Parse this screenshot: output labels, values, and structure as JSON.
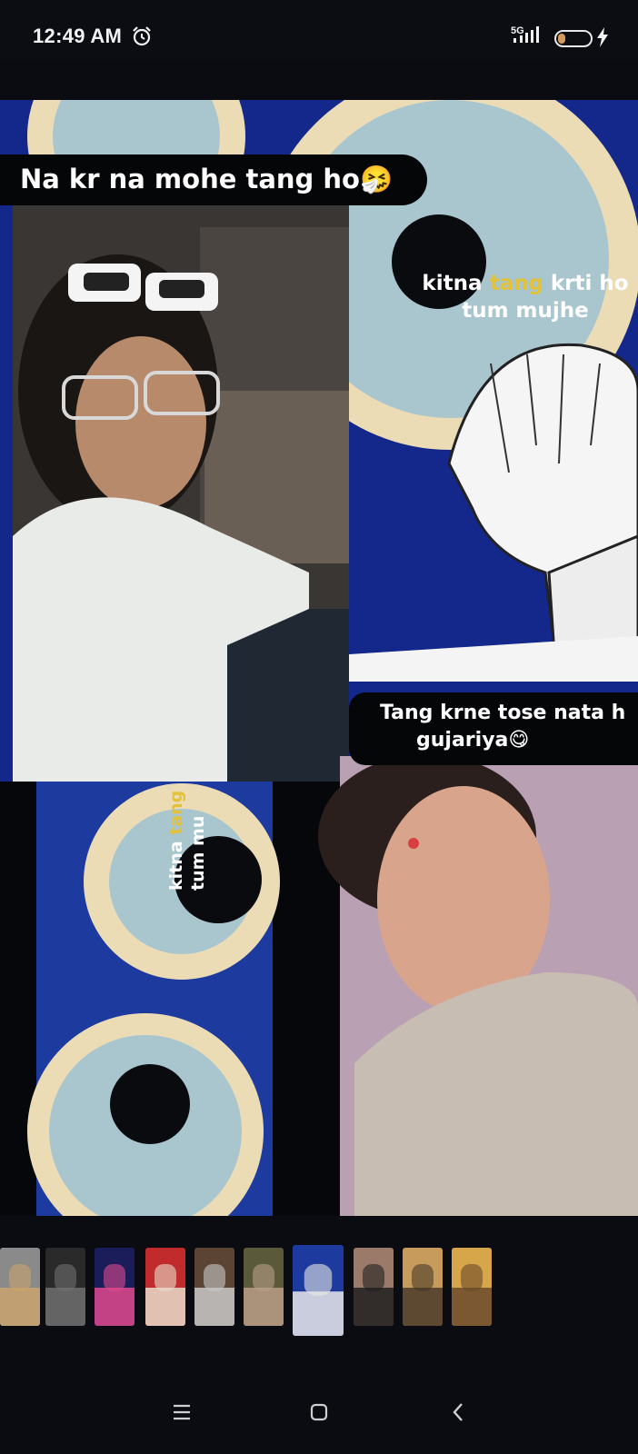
{
  "status_bar": {
    "time": "12:49 AM",
    "network": "5G",
    "battery_level": "23",
    "battery_percent": 23,
    "icons": [
      "alarm-icon",
      "signal-icon",
      "battery-icon",
      "charging-bolt-icon"
    ]
  },
  "viewer": {
    "caption_top": "Na kr na mohe tang ho🤧",
    "overlay_top": {
      "before": "kitna ",
      "highlight": "tang",
      "after": " krti ho",
      "line2": "tum mujhe"
    },
    "caption_middle": {
      "line1": "Tang krne tose nata h",
      "line2": "gujariya😋"
    },
    "overlay_rotated": {
      "before": "kitna ",
      "highlight": "tang",
      "line2": "tum mu"
    },
    "colors": {
      "evil_eye_blue": "#1d3a9e",
      "evil_eye_cream": "#ecdcb6",
      "evil_eye_light_blue": "#a9c6cf",
      "highlight_yellow": "#e3c23a"
    }
  },
  "thumbnails": [
    {
      "color_a": "#8a8a8a",
      "color_b": "#c9a36d"
    },
    {
      "color_a": "#2a2a2a",
      "color_b": "#6f6f6f"
    },
    {
      "color_a": "#1b1d5a",
      "color_b": "#e0498e"
    },
    {
      "color_a": "#c22b2b",
      "color_b": "#e6dcc9"
    },
    {
      "color_a": "#5b4434",
      "color_b": "#c8c8c8"
    },
    {
      "color_a": "#5a5a3a",
      "color_b": "#b89d86"
    },
    {
      "color_a": "#1d3a9e",
      "color_b": "#e8e8e8",
      "active": true
    },
    {
      "color_a": "#9b7a6a",
      "color_b": "#202020"
    },
    {
      "color_a": "#c79b5b",
      "color_b": "#4a3a2a"
    },
    {
      "color_a": "#d8a64a",
      "color_b": "#6b4a2a"
    }
  ],
  "nav_bar": {
    "icons": [
      "menu-icon",
      "home-square-icon",
      "back-chevron-icon"
    ]
  }
}
